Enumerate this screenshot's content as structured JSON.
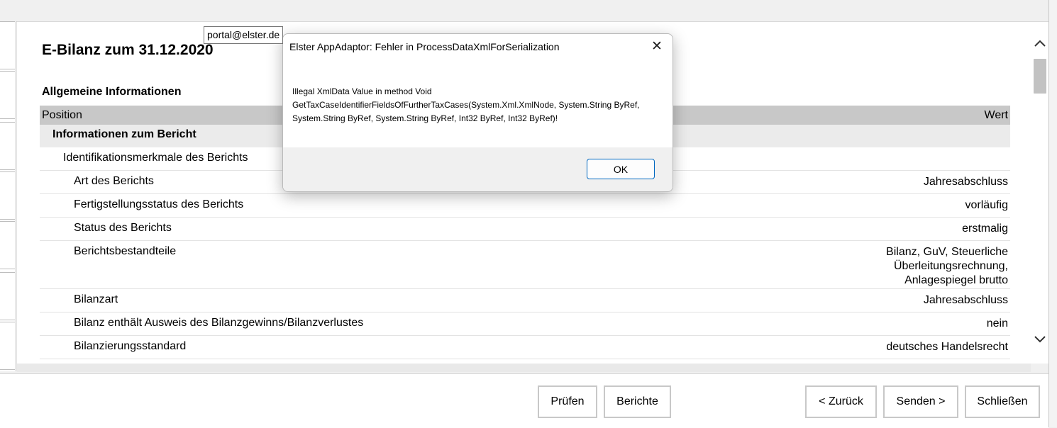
{
  "page": {
    "title": "E-Bilanz zum 31.12.2020",
    "section_title": "Allgemeine Informationen",
    "table": {
      "col_position": "Position",
      "col_wert": "Wert",
      "group": "Informationen zum Bericht",
      "subgroup": "Identifikationsmerkmale des Berichts",
      "rows": [
        {
          "label": "Art des Berichts",
          "value": "Jahresabschluss"
        },
        {
          "label": "Fertigstellungsstatus des Berichts",
          "value": "vorläufig"
        },
        {
          "label": "Status des Berichts",
          "value": "erstmalig"
        },
        {
          "label": "Berichtsbestandteile",
          "value": "Bilanz, GuV, Steuerliche Überleitungsrechnung, Anlagespiegel brutto"
        },
        {
          "label": "Bilanzart",
          "value": "Jahresabschluss"
        },
        {
          "label": "Bilanz enthält Ausweis des Bilanzgewinns/Bilanzverlustes",
          "value": "nein"
        },
        {
          "label": "Bilanzierungsstandard",
          "value": "deutsches Handelsrecht"
        }
      ]
    }
  },
  "tooltip": "portal@elster.de",
  "dialog": {
    "title": "Elster AppAdaptor: Fehler in ProcessDataXmlForSerialization",
    "message": "Illegal XmlData Value in method Void GetTaxCaseIdentifierFieldsOfFurtherTaxCases(System.Xml.XmlNode, System.String ByRef, System.String ByRef, System.String ByRef, Int32 ByRef, Int32 ByRef)!",
    "ok_label": "OK",
    "close_glyph": "✕"
  },
  "buttons": {
    "pruefen": "Prüfen",
    "berichte": "Berichte",
    "zurueck": "< Zurück",
    "senden": "Senden >",
    "schliessen": "Schließen"
  },
  "icons": {
    "scroll_up": "chevron-up-icon",
    "scroll_down": "chevron-down-icon",
    "close": "close-icon"
  }
}
